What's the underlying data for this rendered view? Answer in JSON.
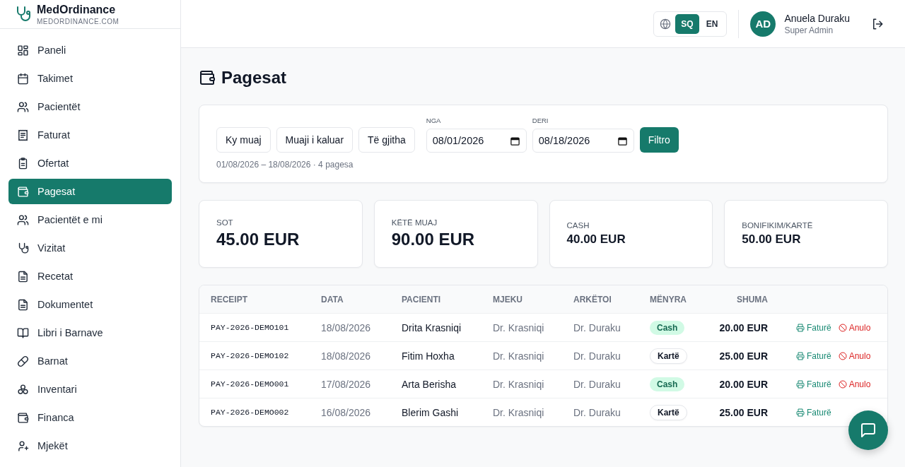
{
  "brand": {
    "name": "MedOrdinance",
    "domain": "MEDORDINANCE.COM"
  },
  "sidebar": {
    "items": [
      {
        "label": "Paneli",
        "selected": false
      },
      {
        "label": "Takimet",
        "selected": false
      },
      {
        "label": "Pacientët",
        "selected": false
      },
      {
        "label": "Faturat",
        "selected": false
      },
      {
        "label": "Ofertat",
        "selected": false
      },
      {
        "label": "Pagesat",
        "selected": true
      },
      {
        "label": "Pacientët e mi",
        "selected": false
      },
      {
        "label": "Vizitat",
        "selected": false
      },
      {
        "label": "Recetat",
        "selected": false
      },
      {
        "label": "Dokumentet",
        "selected": false
      },
      {
        "label": "Libri i Barnave",
        "selected": false
      },
      {
        "label": "Barnat",
        "selected": false
      },
      {
        "label": "Inventari",
        "selected": false
      },
      {
        "label": "Financa",
        "selected": false
      },
      {
        "label": "Mjekët",
        "selected": false
      }
    ]
  },
  "header": {
    "languages": [
      {
        "label": "SQ",
        "selected": true
      },
      {
        "label": "EN",
        "selected": false
      }
    ],
    "user": {
      "initials": "AD",
      "name": "Anuela Duraku",
      "role": "Super Admin"
    }
  },
  "page": {
    "title": "Pagesat"
  },
  "filters": {
    "presets": [
      "Ky muaj",
      "Muaji i kaluar",
      "Të gjitha"
    ],
    "from": {
      "label": "NGA",
      "value": "08/01/2026"
    },
    "to": {
      "label": "DERI",
      "value": "08/18/2026"
    },
    "apply": "Filtro",
    "summary": "01/08/2026 – 18/08/2026 · 4 pagesa"
  },
  "stats": [
    {
      "label": "SOT",
      "value": "45.00 EUR",
      "kind": "primary"
    },
    {
      "label": "KËTË MUAJ",
      "value": "90.00 EUR",
      "kind": "primary"
    },
    {
      "label": "CASH",
      "value": "40.00 EUR",
      "kind": "secondary"
    },
    {
      "label": "BONIFIKIM/KARTË",
      "value": "50.00 EUR",
      "kind": "secondary"
    }
  ],
  "table": {
    "columns": [
      "RECEIPT",
      "DATA",
      "PACIENTI",
      "MJEKU",
      "ARKËTOI",
      "MËNYRA",
      "SHUMA"
    ],
    "rows": [
      {
        "receipt": "PAY-2026-DEMO101",
        "date": "18/08/2026",
        "patient": "Drita Krasniqi",
        "doctor": "Dr. Krasniqi",
        "cashier": "Dr. Duraku",
        "method": {
          "label": "Cash",
          "kind": "cash"
        },
        "amount": "20.00 EUR",
        "actions": [
          "Faturë",
          "Anulo"
        ]
      },
      {
        "receipt": "PAY-2026-DEMO102",
        "date": "18/08/2026",
        "patient": "Fitim Hoxha",
        "doctor": "Dr. Krasniqi",
        "cashier": "Dr. Duraku",
        "method": {
          "label": "Kartë",
          "kind": "card"
        },
        "amount": "25.00 EUR",
        "actions": [
          "Faturë",
          "Anulo"
        ]
      },
      {
        "receipt": "PAY-2026-DEMO001",
        "date": "17/08/2026",
        "patient": "Arta Berisha",
        "doctor": "Dr. Krasniqi",
        "cashier": "Dr. Duraku",
        "method": {
          "label": "Cash",
          "kind": "cash"
        },
        "amount": "20.00 EUR",
        "actions": [
          "Faturë",
          "Anulo"
        ]
      },
      {
        "receipt": "PAY-2026-DEMO002",
        "date": "16/08/2026",
        "patient": "Blerim Gashi",
        "doctor": "Dr. Krasniqi",
        "cashier": "Dr. Duraku",
        "method": {
          "label": "Kartë",
          "kind": "card"
        },
        "amount": "25.00 EUR",
        "actions": [
          "Faturë"
        ]
      }
    ]
  }
}
